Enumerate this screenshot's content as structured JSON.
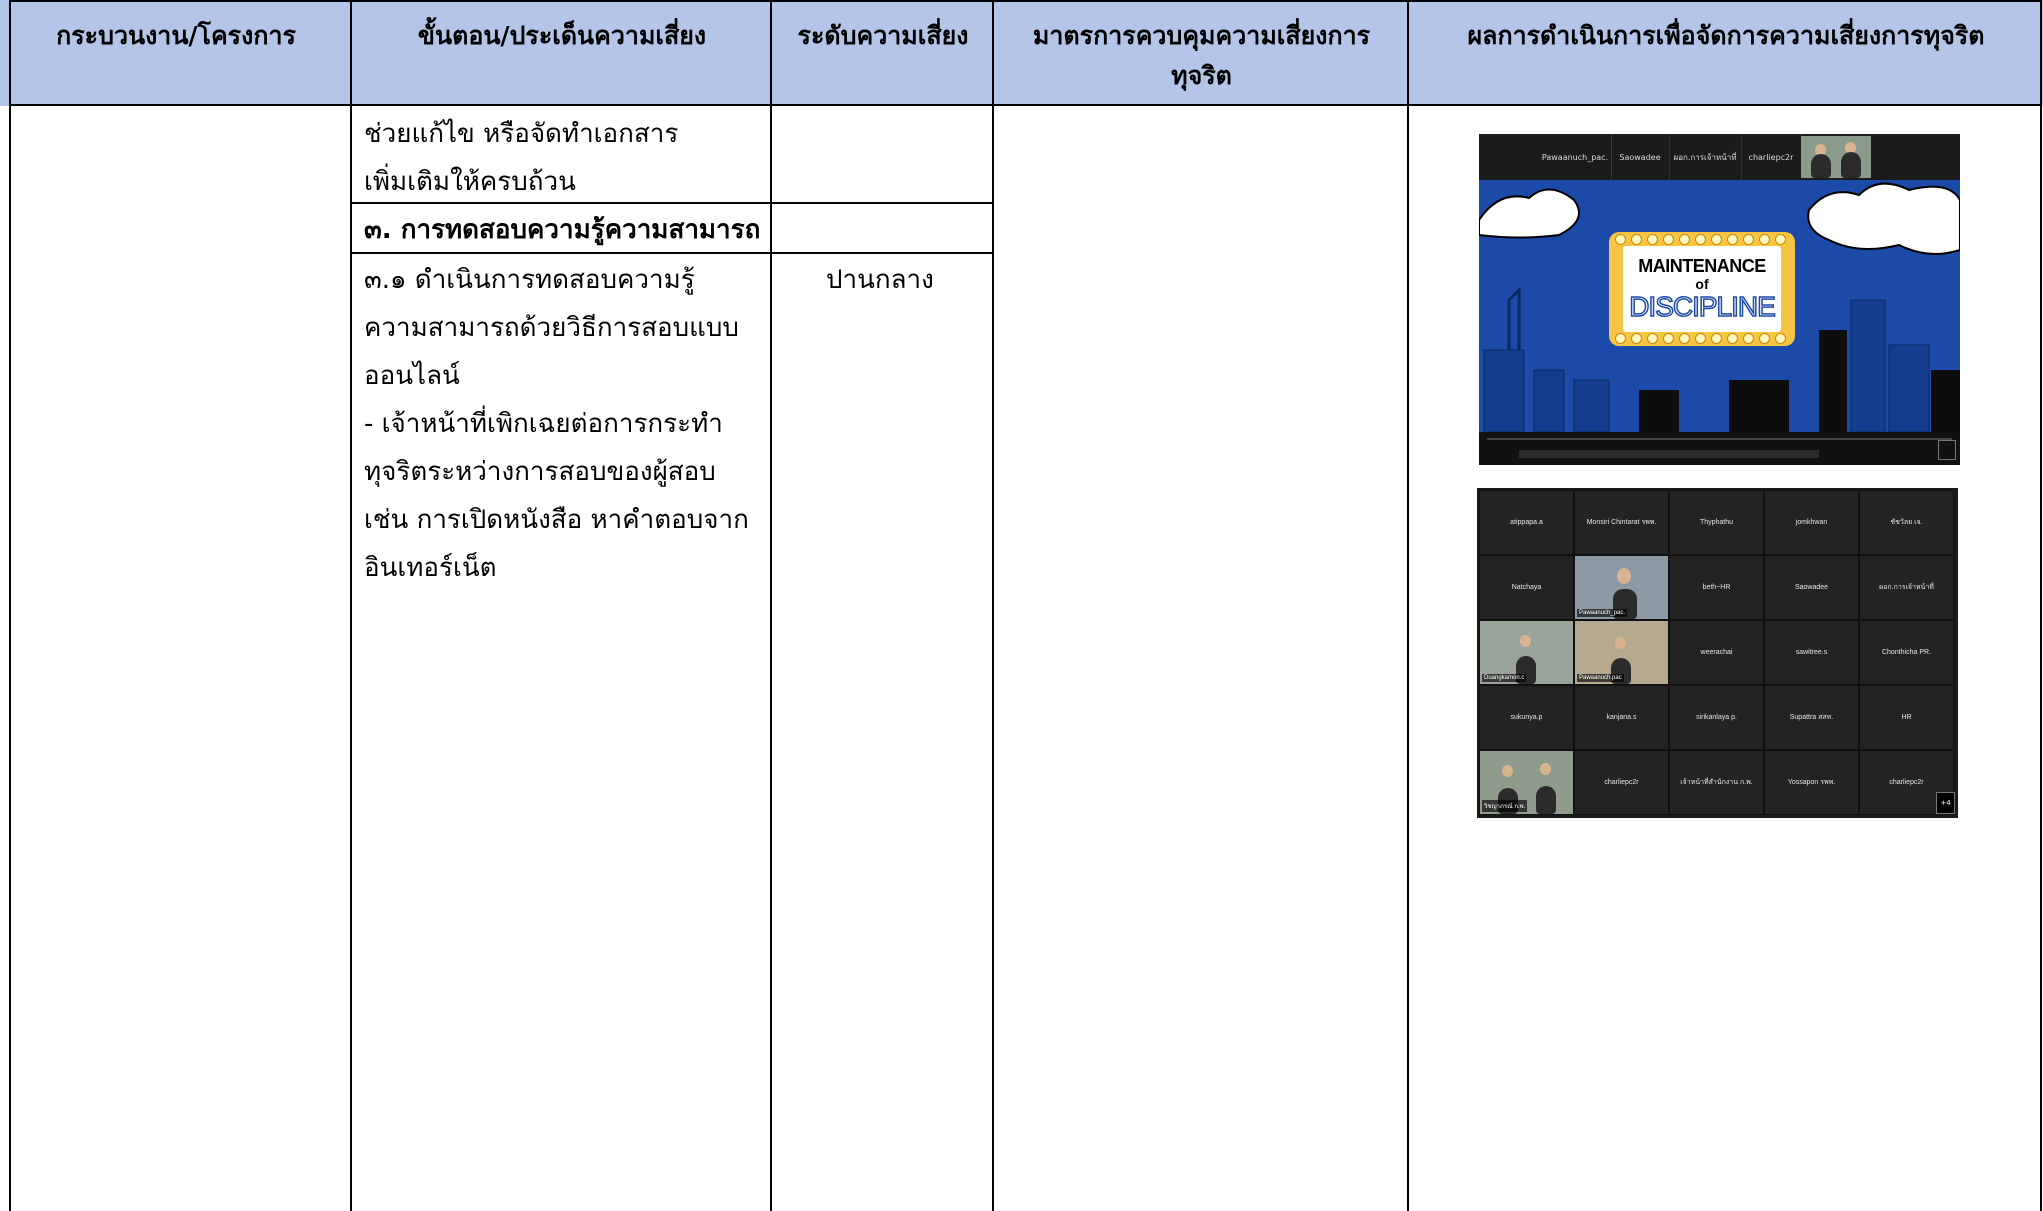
{
  "headers": [
    "กระบวนงาน/โครงการ",
    "ขั้นตอน/ประเด็นความเสี่ยง",
    "ระดับความเสี่ยง",
    "มาตรการควบคุมความเสี่ยงการทุจริต",
    "ผลการดำเนินการเพื่อจัดการความเสี่ยงการทุจริต"
  ],
  "rows": {
    "continuation_line1": "ช่วยแก้ไข หรือจัดทำเอกสาร",
    "continuation_line2": "เพิ่มเติมให้ครบถ้วน",
    "section_heading": "๓. การทดสอบความรู้ความสามารถ",
    "item_lines": [
      "๓.๑ ดำเนินการทดสอบความรู้",
      "ความสามารถด้วยวิธีการสอบแบบ",
      "ออนไลน์",
      "- เจ้าหน้าที่เพิกเฉยต่อการกระทำ",
      "ทุจริตระหว่างการสอบของผู้สอบ",
      "เช่น การเปิดหนังสือ หาคำตอบจาก",
      "อินเทอร์เน็ต"
    ],
    "risk_level": "ปานกลาง"
  },
  "screenshot_video": {
    "participants": [
      "Pawaanuch_pac.",
      "Saowadee",
      "ผอก.การเจ้าหน้าที่",
      "charliepc2r"
    ],
    "slide_title": "MAINTENANCE",
    "slide_of": "of",
    "slide_word": "DISCIPLINE",
    "colors": {
      "slide_bg": "#1c4aa8",
      "marquee": "#f6c544"
    }
  },
  "screenshot_grid": {
    "tiles": [
      "atippapa.a",
      "Monsiri Chintarat รพพ.",
      "Thyphathu",
      "jomkhwan",
      "ชัชวัลย เจ.",
      "Natchaya",
      "",
      "beth~HR",
      "Saowadee",
      "ผอก.การเจ้าหน้าที่",
      "",
      "",
      "weerachai",
      "sawitree.s",
      "Chonthicha PR.",
      "sukunya.p",
      "kanjana.s",
      "sirikanlaya p.",
      "Supattra สสท.",
      "HR",
      "",
      "charliepc2r",
      "เจ้าหน้าที่สำนักงาน ก.พ.",
      "Yossapon รพพ.",
      "charliepc2r"
    ],
    "video_labels": [
      "Pawaanuch_pac.",
      "Duangkamon.c",
      "Pawaanuch.pac",
      "วิชญาภรณ์ ก.พ."
    ],
    "more_label": "+4"
  }
}
